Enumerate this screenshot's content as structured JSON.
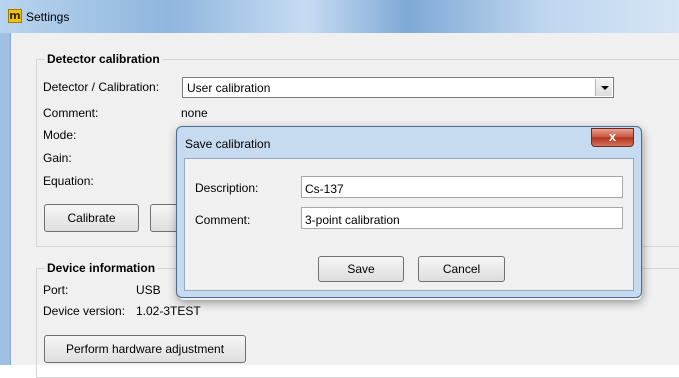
{
  "window": {
    "title": "Settings",
    "icon": "m-app-icon"
  },
  "calibration": {
    "group_title": "Detector calibration",
    "detector_label": "Detector / Calibration:",
    "detector_value": "User calibration",
    "comment_label": "Comment:",
    "comment_value": "none",
    "mode_label": "Mode:",
    "gain_label": "Gain:",
    "equation_label": "Equation:",
    "calibrate_button": "Calibrate"
  },
  "device": {
    "group_title": "Device information",
    "port_label": "Port:",
    "port_value": "USB",
    "version_label": "Device version:",
    "version_value": "1.02-3TEST",
    "hardware_button": "Perform hardware adjustment"
  },
  "dialog": {
    "title": "Save calibration",
    "close_glyph": "x",
    "description_label": "Description:",
    "description_value": "Cs-137",
    "comment_label": "Comment:",
    "comment_value": "3-point calibration",
    "save_button": "Save",
    "cancel_button": "Cancel"
  }
}
